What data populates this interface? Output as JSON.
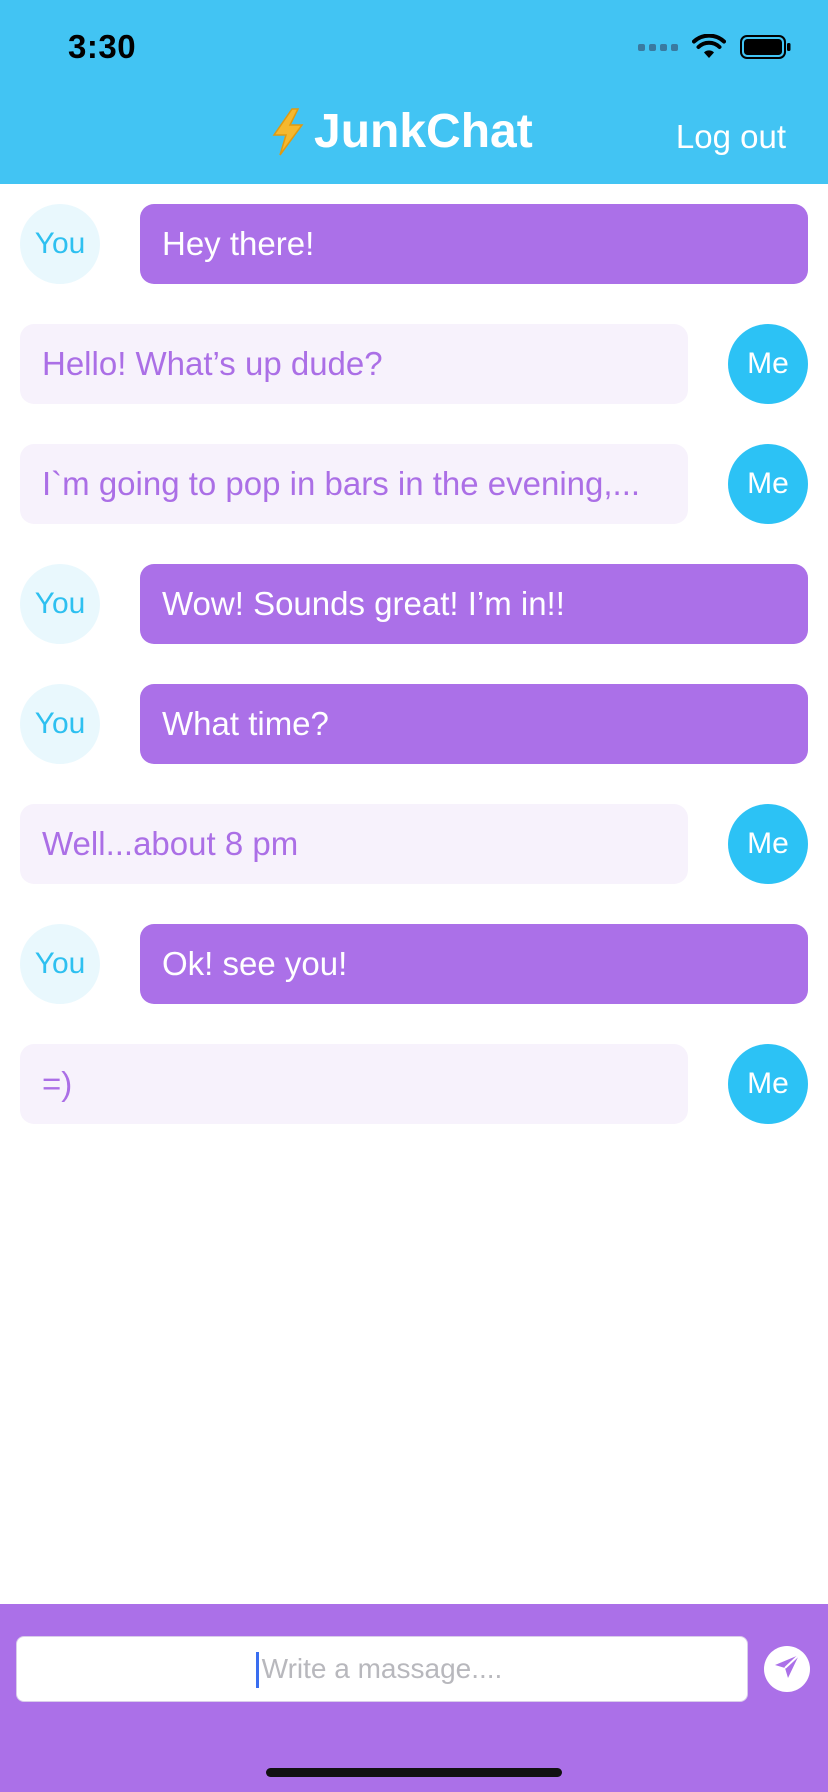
{
  "status_bar": {
    "time": "3:30"
  },
  "header": {
    "title": "JunkChat",
    "logout_label": "Log out",
    "background_color": "#42C4F3"
  },
  "messages": [
    {
      "sender": "You",
      "text": "Hey there!"
    },
    {
      "sender": "Me",
      "text": "Hello! What’s up dude?"
    },
    {
      "sender": "Me",
      "text": "I`m going to pop in bars in the evening,..."
    },
    {
      "sender": "You",
      "text": "Wow! Sounds great! I’m in!!"
    },
    {
      "sender": "You",
      "text": "What time?"
    },
    {
      "sender": "Me",
      "text": "Well...about 8 pm"
    },
    {
      "sender": "You",
      "text": "Ok! see you!"
    },
    {
      "sender": "Me",
      "text": "=)"
    }
  ],
  "composer": {
    "placeholder": "Write a massage....",
    "value": "",
    "send_icon": "paper-plane-icon"
  },
  "colors": {
    "accent_purple": "#AB70E8",
    "accent_blue": "#2CC2F5"
  }
}
